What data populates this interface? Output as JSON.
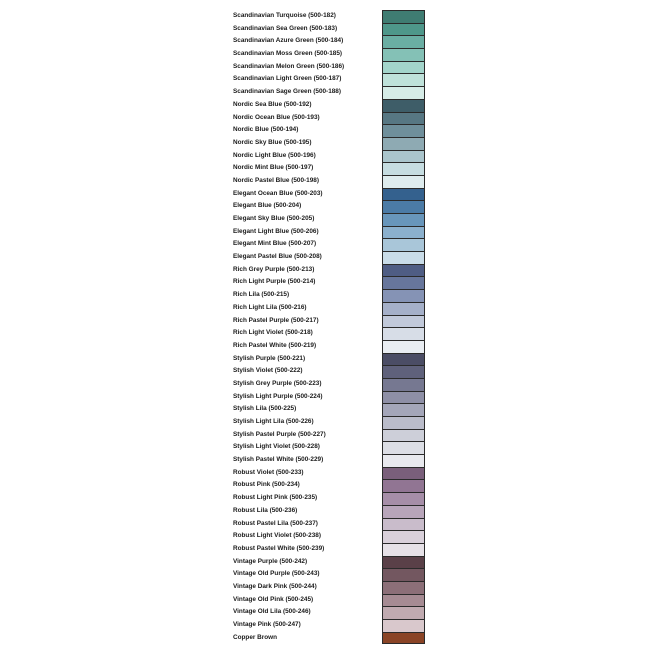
{
  "colors": [
    {
      "name": "Scandinavian Turquoise (500-182)",
      "hex": "#3f7c72"
    },
    {
      "name": "Scandinavian Sea Green (500-183)",
      "hex": "#4e978a"
    },
    {
      "name": "Scandinavian Azure Green (500-184)",
      "hex": "#6aaea3"
    },
    {
      "name": "Scandinavian Moss Green (500-185)",
      "hex": "#84c1b6"
    },
    {
      "name": "Scandinavian Melon Green (500-186)",
      "hex": "#a3d5cb"
    },
    {
      "name": "Scandinavian Light Green (500-187)",
      "hex": "#bfe2da"
    },
    {
      "name": "Scandinavian Sage Green (500-188)",
      "hex": "#d6ece7"
    },
    {
      "name": "Nordic Sea Blue (500-192)",
      "hex": "#3e5d68"
    },
    {
      "name": "Nordic Ocean Blue (500-193)",
      "hex": "#577783"
    },
    {
      "name": "Nordic Blue (500-194)",
      "hex": "#6f8f9b"
    },
    {
      "name": "Nordic Sky Blue (500-195)",
      "hex": "#8eaab3"
    },
    {
      "name": "Nordic Light Blue (500-196)",
      "hex": "#aac5cc"
    },
    {
      "name": "Nordic Mint Blue (500-197)",
      "hex": "#c6dde1"
    },
    {
      "name": "Nordic Pastel Blue (500-198)",
      "hex": "#deecee"
    },
    {
      "name": "Elegant Ocean Blue (500-203)",
      "hex": "#34618e"
    },
    {
      "name": "Elegant Blue (500-204)",
      "hex": "#4b7ba6"
    },
    {
      "name": "Elegant Sky Blue (500-205)",
      "hex": "#6896bb"
    },
    {
      "name": "Elegant Light Blue (500-206)",
      "hex": "#8bb0cd"
    },
    {
      "name": "Elegant Mint Blue (500-207)",
      "hex": "#a9c6d9"
    },
    {
      "name": "Elegant Pastel Blue (500-208)",
      "hex": "#c9dce8"
    },
    {
      "name": "Rich Grey Purple (500-213)",
      "hex": "#4f5d84"
    },
    {
      "name": "Rich Light Purple (500-214)",
      "hex": "#67769c"
    },
    {
      "name": "Rich Lila (500-215)",
      "hex": "#8593b5"
    },
    {
      "name": "Rich Light Lila (500-216)",
      "hex": "#a5b0c9"
    },
    {
      "name": "Rich Pastel Purple (500-217)",
      "hex": "#c1c9da"
    },
    {
      "name": "Rich Light Violet (500-218)",
      "hex": "#d7dde7"
    },
    {
      "name": "Rich Pastel White (500-219)",
      "hex": "#e9edf2"
    },
    {
      "name": "Stylish Purple (500-221)",
      "hex": "#4b4d65"
    },
    {
      "name": "Stylish Violet (500-222)",
      "hex": "#5f617b"
    },
    {
      "name": "Stylish Grey Purple (500-223)",
      "hex": "#767891"
    },
    {
      "name": "Stylish Light Purple (500-224)",
      "hex": "#8e8fa6"
    },
    {
      "name": "Stylish Lila (500-225)",
      "hex": "#a4a6b9"
    },
    {
      "name": "Stylish Light Lila (500-226)",
      "hex": "#babcca"
    },
    {
      "name": "Stylish Pastel Purple (500-227)",
      "hex": "#cdcfd9"
    },
    {
      "name": "Stylish Light Violet (500-228)",
      "hex": "#dcdee5"
    },
    {
      "name": "Stylish Pastel White (500-229)",
      "hex": "#e8e9ee"
    },
    {
      "name": "Robust Violet (500-233)",
      "hex": "#7a5f7b"
    },
    {
      "name": "Robust Pink (500-234)",
      "hex": "#917593"
    },
    {
      "name": "Robust Light Pink (500-235)",
      "hex": "#a68ea8"
    },
    {
      "name": "Robust Lila (500-236)",
      "hex": "#b8a5ba"
    },
    {
      "name": "Robust Pastel Lila (500-237)",
      "hex": "#c9bccb"
    },
    {
      "name": "Robust Light Violet (500-238)",
      "hex": "#d9d0da"
    },
    {
      "name": "Robust Pastel White (500-239)",
      "hex": "#e6e1e7"
    },
    {
      "name": "Vintage Purple (500-242)",
      "hex": "#5a4048"
    },
    {
      "name": "Vintage Old Purple (500-243)",
      "hex": "#735760"
    },
    {
      "name": "Vintage Dark Pink (500-244)",
      "hex": "#8c6f78"
    },
    {
      "name": "Vintage Old Pink (500-245)",
      "hex": "#a68b93"
    },
    {
      "name": "Vintage Old Lila (500-246)",
      "hex": "#c0aab0"
    },
    {
      "name": "Vintage Pink (500-247)",
      "hex": "#d9c8cc"
    },
    {
      "name": "Copper Brown",
      "hex": "#8a4426"
    }
  ]
}
